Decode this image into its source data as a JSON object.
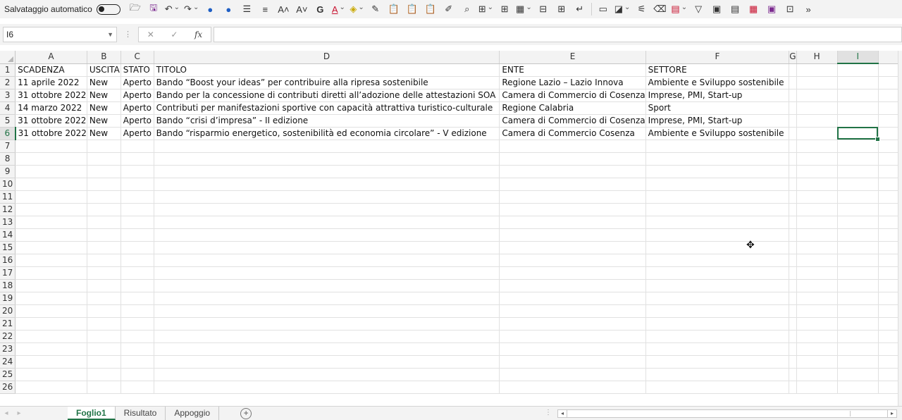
{
  "toolbar": {
    "autosave_label": "Salvataggio automatico",
    "icons": [
      "open-icon",
      "save-icon",
      "undo-icon",
      "redo-icon",
      "circle-icon",
      "circle-icon",
      "align-icon",
      "align-icon",
      "font-increase-icon",
      "font-decrease-icon",
      "bold-icon",
      "font-color-icon",
      "highlight-icon",
      "format-painter-icon",
      "paste-icon",
      "paste-values-icon",
      "paste-format-icon",
      "brush-icon",
      "search-icon",
      "borders-icon",
      "borders-icon",
      "table-icon",
      "freeze-icon",
      "insert-icon",
      "wrap-icon",
      "chart-icon",
      "shapes-icon",
      "conditional-format-icon",
      "clear-icon",
      "fill-icon",
      "filter-icon",
      "pivot-icon",
      "form-icon",
      "calendar-icon",
      "image-icon",
      "screenshot-icon",
      "more-icon"
    ]
  },
  "formula_bar": {
    "name_box": "I6",
    "formula": ""
  },
  "columns": [
    {
      "letter": "A"
    },
    {
      "letter": "B"
    },
    {
      "letter": "C"
    },
    {
      "letter": "D"
    },
    {
      "letter": "E"
    },
    {
      "letter": "F"
    },
    {
      "letter": "G"
    },
    {
      "letter": "H"
    },
    {
      "letter": "I"
    }
  ],
  "rows": [
    {
      "num": "1",
      "cells": [
        "SCADENZA",
        "USCITA",
        "STATO",
        "TITOLO",
        "ENTE",
        "SETTORE",
        "",
        "",
        ""
      ]
    },
    {
      "num": "2",
      "cells": [
        "11 aprile 2022",
        "New",
        "Aperto",
        "Bando “Boost your ideas” per contribuire alla ripresa sostenibile",
        "Regione Lazio – Lazio Innova",
        "Ambiente e Sviluppo sostenibile",
        "",
        "",
        ""
      ]
    },
    {
      "num": "3",
      "cells": [
        "31 ottobre 2022",
        "New",
        "Aperto",
        "Bando per la concessione di contributi diretti all’adozione delle attestazioni SOA",
        "Camera di Commercio di Cosenza",
        "Imprese, PMI, Start-up",
        "",
        "",
        ""
      ]
    },
    {
      "num": "4",
      "cells": [
        "14 marzo 2022",
        "New",
        "Aperto",
        "Contributi per manifestazioni sportive con capacità attrattiva turistico-culturale",
        "Regione Calabria",
        "Sport",
        "",
        "",
        ""
      ]
    },
    {
      "num": "5",
      "cells": [
        "31 ottobre 2022",
        "New",
        "Aperto",
        "Bando “crisi d’impresa” - II edizione",
        "Camera di Commercio di Cosenza",
        "Imprese, PMI, Start-up",
        "",
        "",
        ""
      ]
    },
    {
      "num": "6",
      "cells": [
        "31 ottobre 2022",
        "New",
        "Aperto",
        "Bando “risparmio energetico, sostenibilità ed economia circolare” - V edizione",
        "Camera di Commercio Cosenza",
        "Ambiente e Sviluppo sostenibile",
        "",
        "",
        ""
      ]
    },
    {
      "num": "7",
      "cells": [
        "",
        "",
        "",
        "",
        "",
        "",
        "",
        "",
        ""
      ]
    },
    {
      "num": "8",
      "cells": [
        "",
        "",
        "",
        "",
        "",
        "",
        "",
        "",
        ""
      ]
    },
    {
      "num": "9",
      "cells": [
        "",
        "",
        "",
        "",
        "",
        "",
        "",
        "",
        ""
      ]
    },
    {
      "num": "10",
      "cells": [
        "",
        "",
        "",
        "",
        "",
        "",
        "",
        "",
        ""
      ]
    },
    {
      "num": "11",
      "cells": [
        "",
        "",
        "",
        "",
        "",
        "",
        "",
        "",
        ""
      ]
    },
    {
      "num": "12",
      "cells": [
        "",
        "",
        "",
        "",
        "",
        "",
        "",
        "",
        ""
      ]
    },
    {
      "num": "13",
      "cells": [
        "",
        "",
        "",
        "",
        "",
        "",
        "",
        "",
        ""
      ]
    },
    {
      "num": "14",
      "cells": [
        "",
        "",
        "",
        "",
        "",
        "",
        "",
        "",
        ""
      ]
    },
    {
      "num": "15",
      "cells": [
        "",
        "",
        "",
        "",
        "",
        "",
        "",
        "",
        ""
      ]
    },
    {
      "num": "16",
      "cells": [
        "",
        "",
        "",
        "",
        "",
        "",
        "",
        "",
        ""
      ]
    },
    {
      "num": "17",
      "cells": [
        "",
        "",
        "",
        "",
        "",
        "",
        "",
        "",
        ""
      ]
    },
    {
      "num": "18",
      "cells": [
        "",
        "",
        "",
        "",
        "",
        "",
        "",
        "",
        ""
      ]
    },
    {
      "num": "19",
      "cells": [
        "",
        "",
        "",
        "",
        "",
        "",
        "",
        "",
        ""
      ]
    },
    {
      "num": "20",
      "cells": [
        "",
        "",
        "",
        "",
        "",
        "",
        "",
        "",
        ""
      ]
    },
    {
      "num": "21",
      "cells": [
        "",
        "",
        "",
        "",
        "",
        "",
        "",
        "",
        ""
      ]
    },
    {
      "num": "22",
      "cells": [
        "",
        "",
        "",
        "",
        "",
        "",
        "",
        "",
        ""
      ]
    },
    {
      "num": "23",
      "cells": [
        "",
        "",
        "",
        "",
        "",
        "",
        "",
        "",
        ""
      ]
    },
    {
      "num": "24",
      "cells": [
        "",
        "",
        "",
        "",
        "",
        "",
        "",
        "",
        ""
      ]
    },
    {
      "num": "25",
      "cells": [
        "",
        "",
        "",
        "",
        "",
        "",
        "",
        "",
        ""
      ]
    },
    {
      "num": "26",
      "cells": [
        "",
        "",
        "",
        "",
        "",
        "",
        "",
        "",
        ""
      ]
    }
  ],
  "active_cell": {
    "row": "6",
    "col": "I"
  },
  "sheets": [
    {
      "label": "Foglio1",
      "active": true
    },
    {
      "label": "Risultato",
      "active": false
    },
    {
      "label": "Appoggio",
      "active": false
    }
  ],
  "colors": {
    "accent": "#217346"
  }
}
